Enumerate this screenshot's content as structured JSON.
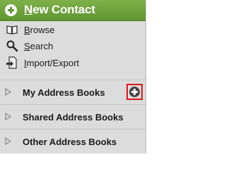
{
  "header": {
    "title_access_key": "N",
    "title_rest": "ew Contact"
  },
  "actions": [
    {
      "access_key": "B",
      "rest": "rowse",
      "icon": "book-icon"
    },
    {
      "access_key": "S",
      "rest": "earch",
      "icon": "search-icon"
    },
    {
      "access_key": "I",
      "rest": "mport/Export",
      "icon": "import-export-icon"
    }
  ],
  "sections": [
    {
      "label": "My Address Books",
      "icon": "expand-triangle-icon",
      "add_icon": "add-address-book-icon"
    },
    {
      "label": "Shared Address Books",
      "icon": "expand-triangle-icon"
    },
    {
      "label": "Other Address Books",
      "icon": "expand-triangle-icon"
    }
  ],
  "colors": {
    "header_green": "#6aa23a",
    "panel_bg": "#dcdcdc",
    "highlight_red": "#e0131a"
  }
}
